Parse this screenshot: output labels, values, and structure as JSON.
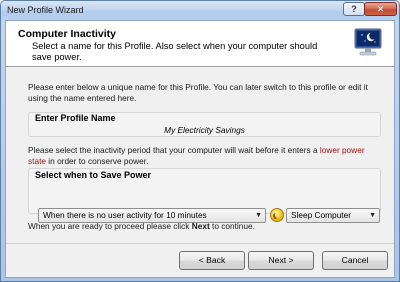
{
  "window": {
    "title": "New Profile Wizard",
    "help_label": "?",
    "close_label": "✕"
  },
  "header": {
    "title": "Computer Inactivity",
    "description": "Select a name for this Profile. Also select when your computer should save power."
  },
  "intro_text": "Please enter below a unique name for this Profile. You can later switch to this profile or edit it using the name entered here.",
  "profile_name": {
    "label": "Enter Profile Name",
    "value": "My Electricity Savings"
  },
  "inactivity_text": {
    "before": "Please select the inactivity period that your computer will wait before it enters a ",
    "highlight": "lower power state",
    "after": " in order to conserve power.",
    "highlight_color": "#b01010"
  },
  "save_power": {
    "label": "Select when to Save Power",
    "inactivity_option": "When there is no user activity for 10 minutes",
    "action_option": "Sleep Computer",
    "icon": "sleep-moon-icon"
  },
  "proceed_text": {
    "before": "When you are ready to proceed please click ",
    "bold": "Next",
    "after": " to continue."
  },
  "buttons": {
    "back": "< Back",
    "next": "Next >",
    "cancel": "Cancel"
  }
}
